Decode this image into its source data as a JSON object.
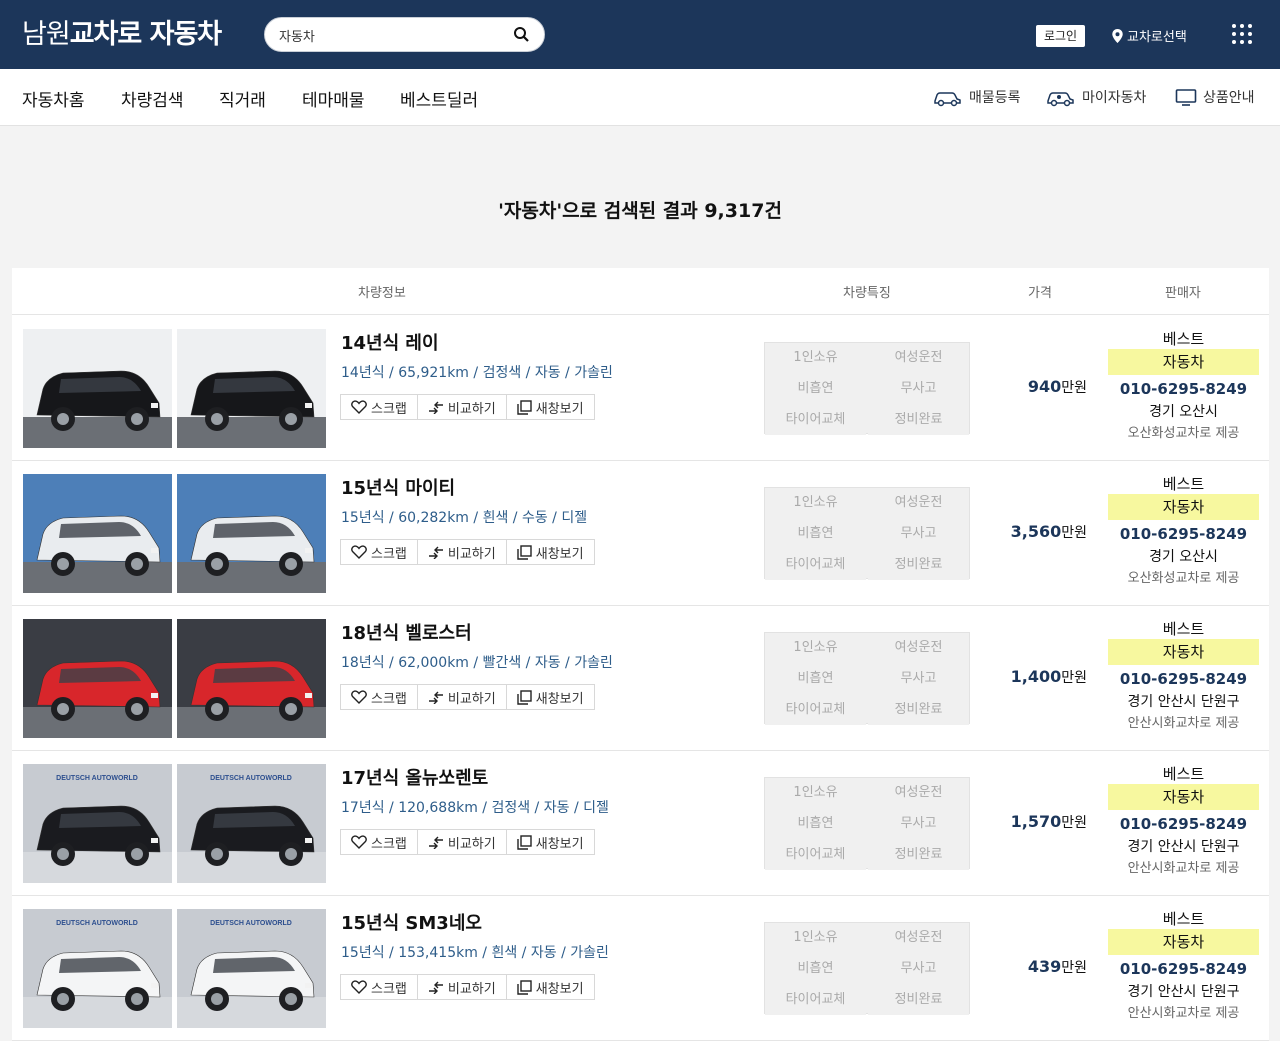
{
  "header": {
    "logo_light": "남원",
    "logo_bold": "교차로 자동차",
    "search_value": "자동차",
    "login_label": "로그인",
    "region_label": "교차로선택"
  },
  "nav": {
    "items": [
      "자동차홈",
      "차량검색",
      "직거래",
      "테마매물",
      "베스트딜러"
    ],
    "utils": [
      "매물등록",
      "마이자동차",
      "상품안내"
    ]
  },
  "result_title": "'자동차'으로 검색된 결과 9,317건",
  "table_headers": [
    "차량정보",
    "차량특징",
    "가격",
    "판매자"
  ],
  "listings": [
    {
      "title": "14년식 레이",
      "info": [
        "14년식",
        "65,921km",
        "검정색",
        "자동",
        "가솔린"
      ],
      "price": "940",
      "price_unit": "만원",
      "seller_grade": "베스트",
      "seller_type": "자동차",
      "phone": "010-6295-8249",
      "location": "경기 오산시",
      "provider": "오산화성교차로 제공",
      "car_color": "#16171a",
      "bg_color": "#eef0f2"
    },
    {
      "title": "15년식 마이티",
      "info": [
        "15년식",
        "60,282km",
        "흰색",
        "수동",
        "디젤"
      ],
      "price": "3,560",
      "price_unit": "만원",
      "seller_grade": "베스트",
      "seller_type": "자동차",
      "phone": "010-6295-8249",
      "location": "경기 오산시",
      "provider": "오산화성교차로 제공",
      "car_color": "#e9ecef",
      "bg_color": "#4d7fb8"
    },
    {
      "title": "18년식 벨로스터",
      "info": [
        "18년식",
        "62,000km",
        "빨간색",
        "자동",
        "가솔린"
      ],
      "price": "1,400",
      "price_unit": "만원",
      "seller_grade": "베스트",
      "seller_type": "자동차",
      "phone": "010-6295-8249",
      "location": "경기 안산시 단원구",
      "provider": "안산시화교차로 제공",
      "car_color": "#d8262b",
      "bg_color": "#3a3d44"
    },
    {
      "title": "17년식 올뉴쏘렌토",
      "info": [
        "17년식",
        "120,688km",
        "검정색",
        "자동",
        "디젤"
      ],
      "price": "1,570",
      "price_unit": "만원",
      "seller_grade": "베스트",
      "seller_type": "자동차",
      "phone": "010-6295-8249",
      "location": "경기 안산시 단원구",
      "provider": "안산시화교차로 제공",
      "car_color": "#1a1b1f",
      "bg_color": "#c7cbd1"
    },
    {
      "title": "15년식 SM3네오",
      "info": [
        "15년식",
        "153,415km",
        "흰색",
        "자동",
        "가솔린"
      ],
      "price": "439",
      "price_unit": "만원",
      "seller_grade": "베스트",
      "seller_type": "자동차",
      "phone": "010-6295-8249",
      "location": "경기 안산시 단원구",
      "provider": "안산시화교차로 제공",
      "car_color": "#f4f5f6",
      "bg_color": "#c7cbd1"
    }
  ],
  "features": [
    "1인소유",
    "여성운전",
    "비흡연",
    "무사고",
    "타이어교체",
    "정비완료"
  ],
  "actions": [
    "스크랩",
    "비교하기",
    "새창보기"
  ],
  "photo_watermark": "DEUTSCH AUTOWORLD"
}
